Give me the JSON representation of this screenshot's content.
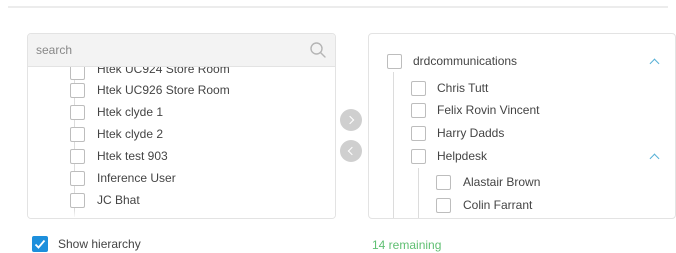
{
  "left_panel": {
    "search_placeholder": "search",
    "items": [
      "Htek UC924 Store Room",
      "Htek UC926 Store Room",
      "Htek clyde 1",
      "Htek clyde 2",
      "Htek test 903",
      "Inference User",
      "JC Bhat"
    ]
  },
  "right_panel": {
    "group": "drdcommunications",
    "members": [
      "Chris Tutt",
      "Felix Rovin Vincent",
      "Harry Dadds"
    ],
    "subgroup": "Helpdesk",
    "subgroup_members": [
      "Alastair Brown",
      "Colin Farrant"
    ]
  },
  "transfer": {
    "right_icon": "chevron-right-icon",
    "left_icon": "chevron-left-icon"
  },
  "footer": {
    "show_hierarchy_label": "Show hierarchy",
    "show_hierarchy_checked": true,
    "remaining_text": "14 remaining"
  },
  "colors": {
    "accent": "#1d8fdc",
    "chevron": "#56b0d6",
    "remaining": "#5fbf72"
  }
}
